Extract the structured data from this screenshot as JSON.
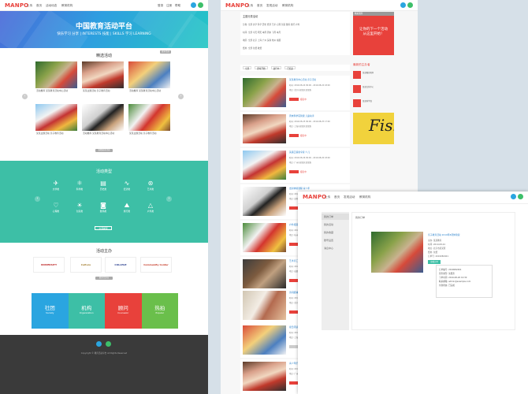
{
  "brand": {
    "logo": "MANPO",
    "accent": "#e8413b",
    "teal": "#3dbfa6"
  },
  "p1": {
    "nav": [
      "上传",
      "首页",
      "活动动态",
      "教育机构"
    ],
    "nav_right": [
      "登录",
      "注册",
      "帮助"
    ],
    "hero_title": "中国教育活动平台",
    "hero_sub": "快乐学习 分享 | INTERESTS 技能 | SKILLS 学习 LEARNING",
    "featured_title": "精选活动",
    "more": "更多活动",
    "cards": [
      "活动推荐 某某教育活动中心活动",
      "某某主题活动 亲子教育活动",
      "活动推荐 某某教育活动中心活动",
      "某某主题活动 亲子教育活动",
      "活动推荐 某某教育活动中心活动",
      "某某主题活动 亲子教育活动",
      "活动推荐 某某教育活动中心活动",
      "某某主题活动 亲子教育活动"
    ],
    "all_btn": "查看更多活动",
    "cat_title": "活动类型",
    "cats": [
      "文学类",
      "科学类",
      "历史类",
      "经济类",
      "艺术类",
      "心理类",
      "创意类",
      "数码类",
      "旅行类",
      "户外类"
    ],
    "cat_btn": "全部类型",
    "org_title": "活动主办",
    "orgs": [
      "UNIVERSITY",
      "Culture",
      "COLLEGE",
      "Community Center"
    ],
    "org_more": "更多主办方",
    "tiles": [
      {
        "a": "社团",
        "b": "Society"
      },
      {
        "a": "机构",
        "b": "Organization"
      },
      {
        "a": "顾问",
        "b": "Counselor"
      },
      {
        "a": "热拍",
        "b": "Popular"
      }
    ],
    "copy": "Copyright ©  教育活动平台 All Rights Reserved"
  },
  "p2": {
    "nav": [
      "上传",
      "首页",
      "发现活动",
      "教育机构"
    ],
    "box_title": "主题分类活动",
    "filters": [
      "分类: 全部 文学 科学 历史 经济 艺术 心理 创意 数码 旅行 户外",
      "时间: 全部 今天 明天 本周 周末 下周 本月",
      "地区: 全部 北京 上海 广州 深圳 杭州 成都",
      "费用: 全部 免费 收费"
    ],
    "ad_tag": "精彩推荐",
    "ad_text": "让你的下一个活动\n从这里开始！",
    "tabs": [
      "全部",
      "即将开始",
      "进行中",
      "已结束"
    ],
    "items": [
      {
        "t": "某某教育中心活动 亲子活动",
        "d": "时间: 2019-08-24 09:00 - 2019-08-24 18:00",
        "l": "地点: 北京市某某区某某路",
        "s": "报名中"
      },
      {
        "t": "周末科学实验课 儿童动手",
        "d": "时间: 2019-08-25 09:00 - 2019-08-25 17:00",
        "l": "地点: 上海市某某区某某路",
        "s": "报名中"
      },
      {
        "t": "英语口语夏令营 少儿",
        "d": "时间: 2019-08-26 09:00 - 2019-08-26 18:00",
        "l": "地点: 广州市某某区某某路",
        "s": "报名中"
      },
      {
        "t": "击剑体验课程 青少年",
        "d": "时间: 2019-08-27 09:00 - 2019-08-27 18:00",
        "l": "地点: 深圳市某某区某某路",
        "s": "报名中"
      },
      {
        "t": "户外拓展训练 亲子",
        "d": "时间: 2019-08-28 09:00 - 2019-08-28 18:00",
        "l": "地点: 杭州市某某区某某路",
        "s": "报名中"
      },
      {
        "t": "艺术手工坊 创意课程",
        "d": "时间: 2019-08-29 09:00 - 2019-08-29 18:00",
        "l": "地点: 成都市某某区某某路",
        "s": "报名中"
      },
      {
        "t": "诗词朗诵大会 传统文化",
        "d": "时间: 2019-08-30 09:00 - 2019-08-30 18:00",
        "l": "地点: 北京市某某区某某路",
        "s": "报名中"
      },
      {
        "t": "夏日阅读分享会 亲子",
        "d": "时间: 2019-08-31 09:00 - 2019-08-31 18:00",
        "l": "地点: 上海市某某区某某路",
        "s": "已结束"
      },
      {
        "t": "青少年乐团招募 音乐",
        "d": "时间: 2019-09-01 09:00 - 2019-09-01 18:00",
        "l": "地点: 广州市某某区某某路",
        "s": "报名中"
      }
    ],
    "side_title": "最新的主办者",
    "side": [
      "某某教育机构",
      "某某文化中心",
      "某某科学馆"
    ]
  },
  "p3": {
    "nav": [
      "上传",
      "首页",
      "发现活动",
      "教育机构"
    ],
    "sidebar": [
      "我的订单",
      "我的活动",
      "我的收藏",
      "账号设置",
      "消息中心"
    ],
    "crumb": "我的订单",
    "title": "亲子教育活动 2019年8月体验营",
    "lines": [
      "主办: 某某教育",
      "时间: 2019-08-24",
      "地点: 北京市某某区",
      "费用: 免费",
      "订单号: 2019082401"
    ],
    "btn": "查看订单",
    "box": [
      "订单编号: 2019082401",
      "票务类型: 免费票",
      "下单时间: 2019-08-20 10:30",
      "联系邮箱: admin@example.com",
      "付款状态: 已完成"
    ]
  }
}
